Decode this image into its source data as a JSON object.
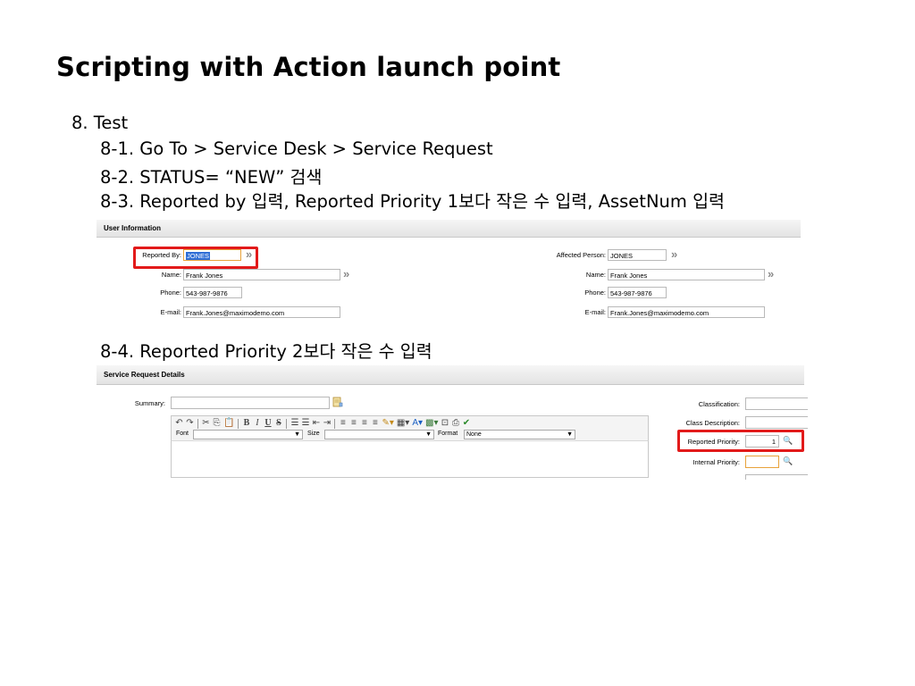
{
  "slide": {
    "title": "Scripting with Action launch point",
    "bullets": {
      "b0": "8. Test",
      "b1": "8-1. Go To > Service Desk > Service Request",
      "b2": "8-2. STATUS= “NEW” 검색",
      "b3": "8-3. Reported by 입력, Reported Priority 1보다 작은 수 입력, AssetNum 입력",
      "b4": "8-4. Reported Priority 2보다 작은 수 입력"
    }
  },
  "user_info": {
    "header": "User Information",
    "left": {
      "reported_by_label": "Reported By:",
      "reported_by_value": "JONES",
      "name_label": "Name:",
      "name_value": "Frank Jones",
      "phone_label": "Phone:",
      "phone_value": "543-987-9876",
      "email_label": "E-mail:",
      "email_value": "Frank.Jones@maximodemo.com"
    },
    "right": {
      "affected_label": "Affected Person:",
      "affected_value": "JONES",
      "name_label": "Name:",
      "name_value": "Frank Jones",
      "phone_label": "Phone:",
      "phone_value": "543-987-9876",
      "email_label": "E-mail:",
      "email_value": "Frank.Jones@maximodemo.com"
    },
    "arrow_glyph": "»"
  },
  "sr_details": {
    "header": "Service Request Details",
    "summary_label": "Summary:",
    "summary_value": "",
    "toolbar_font_label": "Font",
    "toolbar_size_label": "Size",
    "toolbar_format_label": "Format",
    "toolbar_format_value": "None",
    "classification_label": "Classification:",
    "class_desc_label": "Class Description:",
    "reported_priority_label": "Reported Priority:",
    "reported_priority_value": "1",
    "internal_priority_label": "Internal Priority:",
    "internal_priority_value": ""
  },
  "colors": {
    "highlight_box": "#e21a1a",
    "field_focus": "#e8a23a",
    "selection": "#2f6fd6"
  }
}
